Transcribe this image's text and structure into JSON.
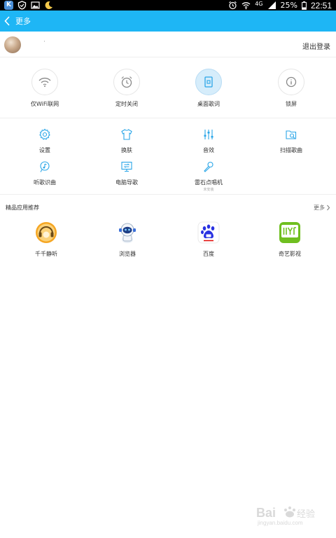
{
  "status_bar": {
    "left_icons": [
      "k-app-icon",
      "shield-icon",
      "image-icon",
      "moon-icon"
    ],
    "right_icons": [
      "alarm-icon",
      "wifi-icon",
      "signal-icon",
      "battery-icon"
    ],
    "network": "4G",
    "battery": "25%",
    "time": "22:51"
  },
  "header": {
    "title": "更多"
  },
  "user": {
    "name": "·",
    "logout_label": "退出登录"
  },
  "quick_toggles": [
    {
      "label": "仅WiFi联网",
      "icon": "wifi-icon"
    },
    {
      "label": "定时关闭",
      "icon": "alarm-clock-icon"
    },
    {
      "label": "桌面歌词",
      "icon": "desktop-lyrics-icon",
      "active": true
    },
    {
      "label": "锁屏",
      "icon": "lock-screen-icon"
    }
  ],
  "functions": [
    {
      "label": "设置",
      "icon": "gear-icon"
    },
    {
      "label": "换肤",
      "icon": "tshirt-icon"
    },
    {
      "label": "音效",
      "icon": "equalizer-icon"
    },
    {
      "label": "扫描歌曲",
      "icon": "scan-folder-icon"
    },
    {
      "label": "听歌识曲",
      "icon": "music-recognition-icon"
    },
    {
      "label": "电脑导歌",
      "icon": "computer-transfer-icon"
    },
    {
      "label": "雷石点唱机",
      "icon": "microphone-icon",
      "sublabel": "未安装"
    }
  ],
  "recommended": {
    "title": "精品应用推荐",
    "more_label": "更多",
    "apps": [
      {
        "label": "千千静听",
        "icon": "qianqian-app-icon"
      },
      {
        "label": "浏览器",
        "icon": "astronaut-browser-icon"
      },
      {
        "label": "百度",
        "icon": "baidu-paw-icon"
      },
      {
        "label": "奇艺影视",
        "icon": "qiyi-app-icon"
      }
    ]
  },
  "watermark": {
    "text": "Bai经验",
    "subtext": "jingyan.baidu.com"
  },
  "colors": {
    "accent": "#1eb6f5",
    "icon_blue": "#2aa6e8",
    "divider": "#efefef"
  }
}
